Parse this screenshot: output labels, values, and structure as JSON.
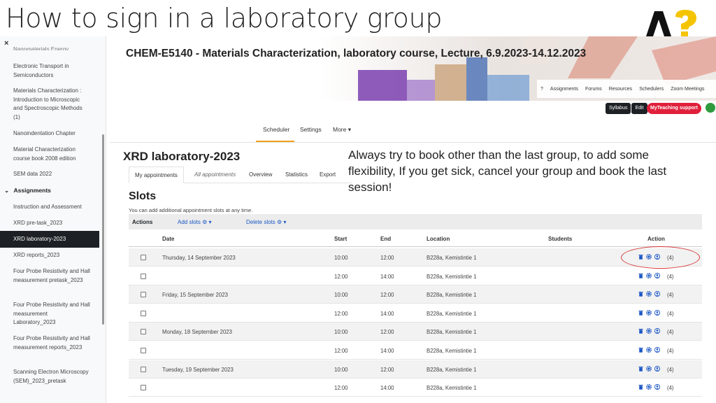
{
  "slide_title": "How to sign in a laboratory group",
  "sidebar": {
    "close_glyph": "×",
    "cut_item": "Nanomaterials Energy",
    "items": [
      "Electronic Transport in Semiconductors",
      "Materials Characterization : Introduction to Microscopic and Spectroscopic Methods (1)",
      "Nanoindentation Chapter",
      "Material Characterization course book 2008 edition",
      "SEM data 2022"
    ],
    "section": "Assignments",
    "section_items": [
      "Instruction and Assessment",
      "XRD pre-task_2023",
      "XRD laboratory-2023",
      "XRD reports_2023",
      "Four Probe Resistivity and Hall measurement pretask_2023",
      "Four Probe Resistivity and Hall measurement Laboratory_2023",
      "Four Probe Resistivity and Hall measurement reports_2023",
      "Scanning Electron Microscopy (SEM)_2023_pretask"
    ]
  },
  "course": {
    "title": "CHEM-E5140 - Materials Characterization, laboratory course, Lecture, 6.9.2023-14.12.2023"
  },
  "topnav": [
    "?",
    "Assignments",
    "Forums",
    "Resources",
    "Schedulers",
    "Zoom Meetings"
  ],
  "buttons": {
    "syllabus": "Syllabus",
    "edit": "Edit",
    "myteaching": "MyTeaching support"
  },
  "subnav": {
    "scheduler": "Scheduler",
    "settings": "Settings",
    "more": "More ▾"
  },
  "page_title": "XRD laboratory-2023",
  "tabs": [
    "My appointments",
    "All appointments",
    "Overview",
    "Statistics",
    "Export"
  ],
  "note": "Always try to book other than the last group, to add some flexibility, If you get sick, cancel your group and book the last session!",
  "slots": {
    "title": "Slots",
    "desc": "You can add additional appointment slots at any time.",
    "actions_label": "Actions",
    "add_slots": "Add slots ⚙ ▾",
    "delete_slots": "Delete slots ⚙ ▾"
  },
  "table": {
    "headers": {
      "date": "Date",
      "start": "Start",
      "end": "End",
      "location": "Location",
      "students": "Students",
      "action": "Action"
    },
    "rows": [
      {
        "date": "Thursday, 14 September 2023",
        "start": "10:00",
        "end": "12:00",
        "location": "B228a, Kemistintie 1",
        "count": "(4)",
        "shade": true
      },
      {
        "date": "",
        "start": "12:00",
        "end": "14:00",
        "location": "B228a, Kemistintie 1",
        "count": "(4)",
        "shade": false
      },
      {
        "date": "Friday, 15 September 2023",
        "start": "10:00",
        "end": "12:00",
        "location": "B228a, Kemistintie 1",
        "count": "(4)",
        "shade": true
      },
      {
        "date": "",
        "start": "12:00",
        "end": "14:00",
        "location": "B228a, Kemistintie 1",
        "count": "(4)",
        "shade": false
      },
      {
        "date": "Monday, 18 September 2023",
        "start": "10:00",
        "end": "12:00",
        "location": "B228a, Kemistintie 1",
        "count": "(4)",
        "shade": true
      },
      {
        "date": "",
        "start": "12:00",
        "end": "14:00",
        "location": "B228a, Kemistintie 1",
        "count": "(4)",
        "shade": false
      },
      {
        "date": "Tuesday, 19 September 2023",
        "start": "10:00",
        "end": "12:00",
        "location": "B228a, Kemistintie 1",
        "count": "(4)",
        "shade": true
      },
      {
        "date": "",
        "start": "12:00",
        "end": "14:00",
        "location": "B228a, Kemistintie 1",
        "count": "(4)",
        "shade": false
      }
    ]
  },
  "colors": {
    "accent_link": "#1a56c4",
    "myteaching_red": "#e0203b",
    "highlight_ellipse": "#d63a3a",
    "tab_underline": "#f4a11c"
  }
}
